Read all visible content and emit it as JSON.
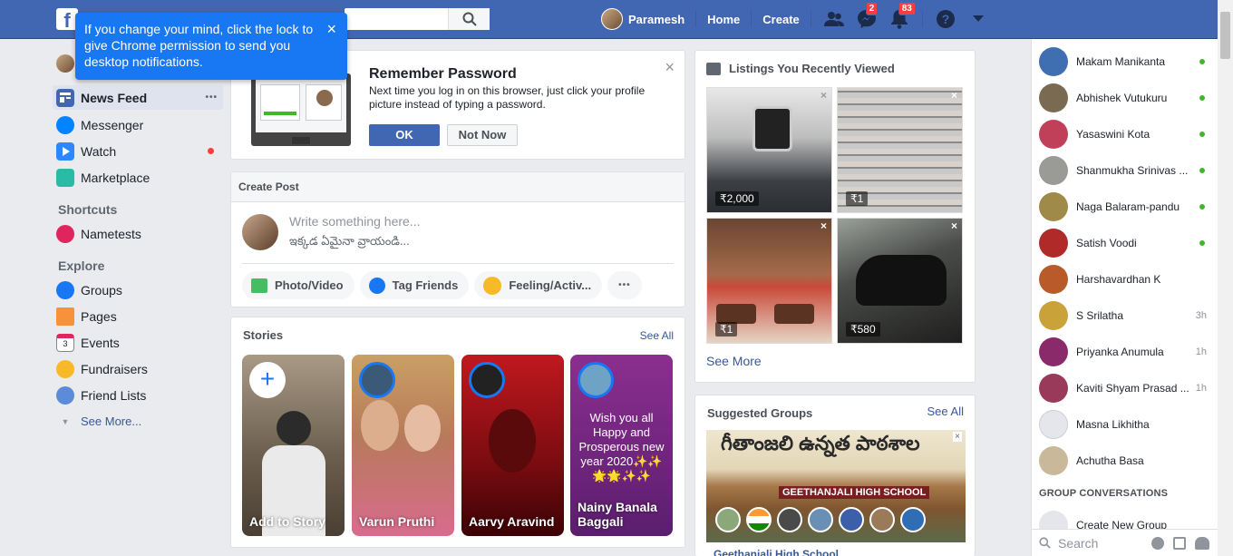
{
  "topbar": {
    "logo": "f",
    "user_name": "Paramesh",
    "home": "Home",
    "create": "Create",
    "messages_badge": "2",
    "notifications_badge": "83"
  },
  "tooltip": {
    "text": "If you change your mind, click the lock to give Chrome permission to send you desktop notifications.",
    "close": "×"
  },
  "leftnav": {
    "items": [
      {
        "label": "News Feed"
      },
      {
        "label": "Messenger"
      },
      {
        "label": "Watch"
      },
      {
        "label": "Marketplace"
      }
    ],
    "more_dots": "•••",
    "shortcuts_heading": "Shortcuts",
    "shortcuts": [
      {
        "label": "Nametests"
      }
    ],
    "explore_heading": "Explore",
    "explore": [
      {
        "label": "Groups"
      },
      {
        "label": "Pages"
      },
      {
        "label": "Events"
      },
      {
        "label": "Fundraisers"
      },
      {
        "label": "Friend Lists"
      }
    ],
    "see_more": "See More..."
  },
  "remember": {
    "title": "Remember Password",
    "body": "Next time you log in on this browser, just click your profile picture instead of typing a password.",
    "ok": "OK",
    "not_now": "Not Now",
    "close": "×"
  },
  "create_post": {
    "title": "Create Post",
    "placeholder": "Write something here...",
    "placeholder_te": "ఇక్కడ ఏమైనా వ్రాయండి...",
    "actions": [
      "Photo/Video",
      "Tag Friends",
      "Feeling/Activ...",
      "•••"
    ]
  },
  "stories": {
    "title": "Stories",
    "see_all": "See All",
    "items": [
      {
        "name": "Add to Story"
      },
      {
        "name": "Varun Pruthi"
      },
      {
        "name": "Aarvy Aravind"
      },
      {
        "name": "Nainy Banala Baggali",
        "text": "Wish you all Happy and Prosperous new year 2020✨✨🌟🌟✨✨"
      }
    ],
    "add_symbol": "+"
  },
  "listings": {
    "title": "Listings You Recently Viewed",
    "items": [
      {
        "price": "₹2,000"
      },
      {
        "price": "₹1"
      },
      {
        "price": "₹1"
      },
      {
        "price": "₹580"
      }
    ],
    "close": "×",
    "see_more": "See More"
  },
  "groups": {
    "title": "Suggested Groups",
    "see_all": "See All",
    "banner_text": "గీతాంజలి ఉన్నత పాఠశాల",
    "banner_sign": "GEETHANJALI HIGH SCHOOL",
    "group_name": "Geethanjali High School",
    "close": "×"
  },
  "contacts": [
    {
      "name": "Makam Manikanta",
      "status": "online"
    },
    {
      "name": "Abhishek Vutukuru",
      "status": "online"
    },
    {
      "name": "Yasaswini Kota",
      "status": "online"
    },
    {
      "name": "Shanmukha Srinivas ...",
      "status": "online"
    },
    {
      "name": "Naga Balaram-pandu",
      "status": "online"
    },
    {
      "name": "Satish Voodi",
      "status": "online"
    },
    {
      "name": "Harshavardhan K",
      "status": ""
    },
    {
      "name": "S Srilatha",
      "status": "3h"
    },
    {
      "name": "Priyanka Anumula",
      "status": "1h"
    },
    {
      "name": "Kaviti Shyam Prasad ...",
      "status": "1h"
    },
    {
      "name": "Masna Likhitha",
      "status": ""
    },
    {
      "name": "Achutha Basa",
      "status": ""
    }
  ],
  "group_conversations": {
    "heading": "GROUP CONVERSATIONS",
    "create": "Create New Group"
  },
  "chat_search": {
    "placeholder": "Search"
  }
}
